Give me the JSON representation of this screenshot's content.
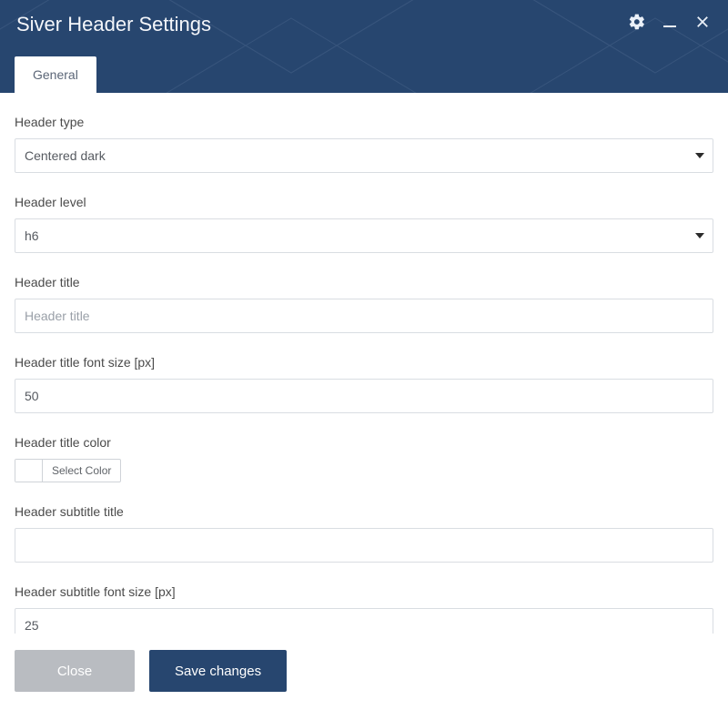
{
  "window": {
    "title": "Siver Header Settings"
  },
  "tabs": [
    {
      "label": "General"
    }
  ],
  "fields": {
    "header_type": {
      "label": "Header type",
      "value": "Centered dark"
    },
    "header_level": {
      "label": "Header level",
      "value": "h6"
    },
    "header_title": {
      "label": "Header title",
      "placeholder": "Header title",
      "value": ""
    },
    "header_title_font_size": {
      "label": "Header title font size [px]",
      "value": "50"
    },
    "header_title_color": {
      "label": "Header title color",
      "button": "Select Color",
      "value": ""
    },
    "header_subtitle_title": {
      "label": "Header subtitle title",
      "value": ""
    },
    "header_subtitle_font_size": {
      "label": "Header subtitle font size [px]",
      "value": "25"
    }
  },
  "footer": {
    "close": "Close",
    "save": "Save changes"
  }
}
